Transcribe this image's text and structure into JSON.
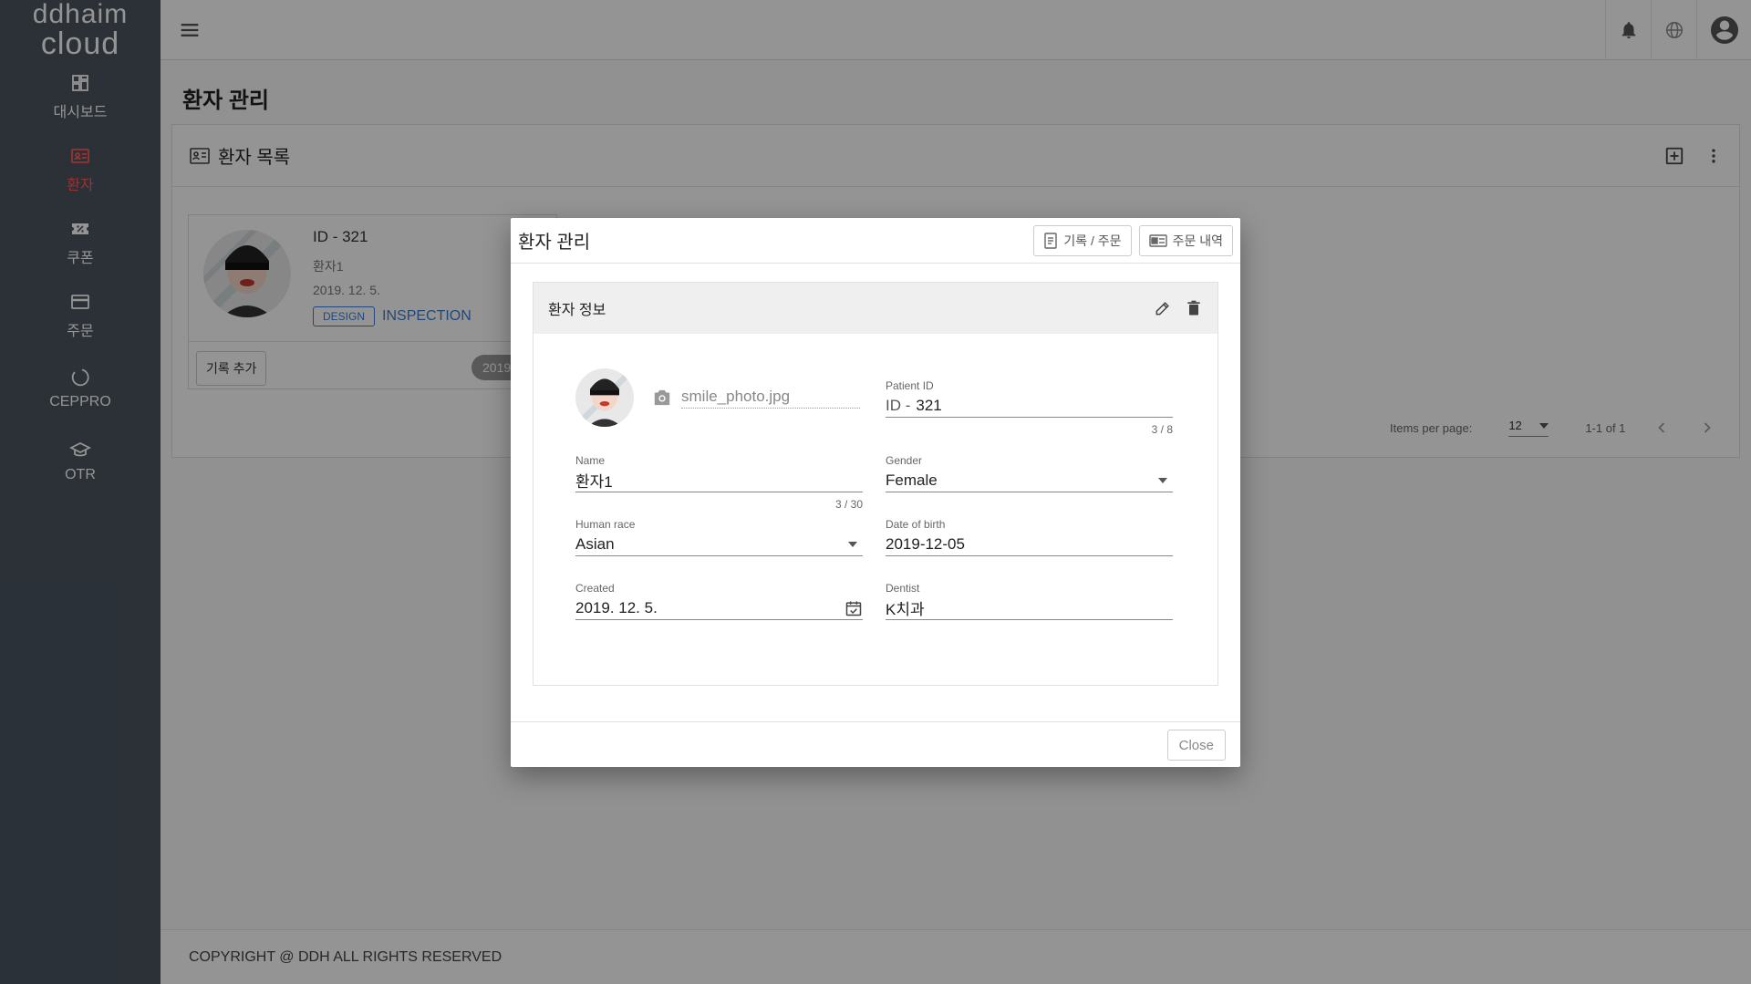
{
  "app": {
    "logo_line1": "ddhaim",
    "logo_line2": "cloud"
  },
  "sidebar": {
    "items": [
      {
        "label": "대시보드",
        "icon": "dashboard-icon",
        "active": false
      },
      {
        "label": "환자",
        "icon": "patient-card-icon",
        "active": true
      },
      {
        "label": "쿠폰",
        "icon": "coupon-icon",
        "active": false
      },
      {
        "label": "주문",
        "icon": "credit-card-icon",
        "active": false
      },
      {
        "label": "CEPPRO",
        "icon": "ceppro-circle-icon",
        "active": false
      },
      {
        "label": "OTR",
        "icon": "graduation-cap-icon",
        "active": false
      }
    ]
  },
  "topbar": {
    "icons": [
      "menu-icon",
      "bell-icon",
      "globe-icon",
      "account-icon"
    ]
  },
  "page": {
    "title": "환자 관리",
    "card_title": "환자 목록"
  },
  "patient_card": {
    "id": "ID - 321",
    "name": "환자1",
    "date": "2019. 12. 5.",
    "badge_design": "DESIGN",
    "badge_inspection": "INSPECTION",
    "add_record_label": "기록 추가",
    "date_chip": "2019."
  },
  "pager": {
    "items_per_page_label": "Items per page:",
    "items_per_page_value": "12",
    "range": "1-1 of 1"
  },
  "footer": {
    "copyright": "COPYRIGHT @ DDH ALL RIGHTS RESERVED"
  },
  "dialog": {
    "title": "환자 관리",
    "btn_record_order": "기록 / 주문",
    "btn_order_history": "주문 내역",
    "section_title": "환자 정보",
    "photo_filename": "smile_photo.jpg",
    "fields": {
      "patient_id": {
        "label": "Patient ID",
        "prefix": "ID -",
        "value": "321",
        "counter": "3 / 8"
      },
      "name": {
        "label": "Name",
        "value": "환자1",
        "counter": "3 / 30"
      },
      "gender": {
        "label": "Gender",
        "value": "Female"
      },
      "human_race": {
        "label": "Human race",
        "value": "Asian"
      },
      "date_of_birth": {
        "label": "Date of birth",
        "value": "2019-12-05"
      },
      "created": {
        "label": "Created",
        "value": "2019. 12. 5."
      },
      "dentist": {
        "label": "Dentist",
        "value": "K치과"
      }
    },
    "close_label": "Close"
  },
  "colors": {
    "sidebar_bg": "#4a5560",
    "active_nav": "#ff5a5a",
    "accent_blue": "#3a7bd5"
  }
}
